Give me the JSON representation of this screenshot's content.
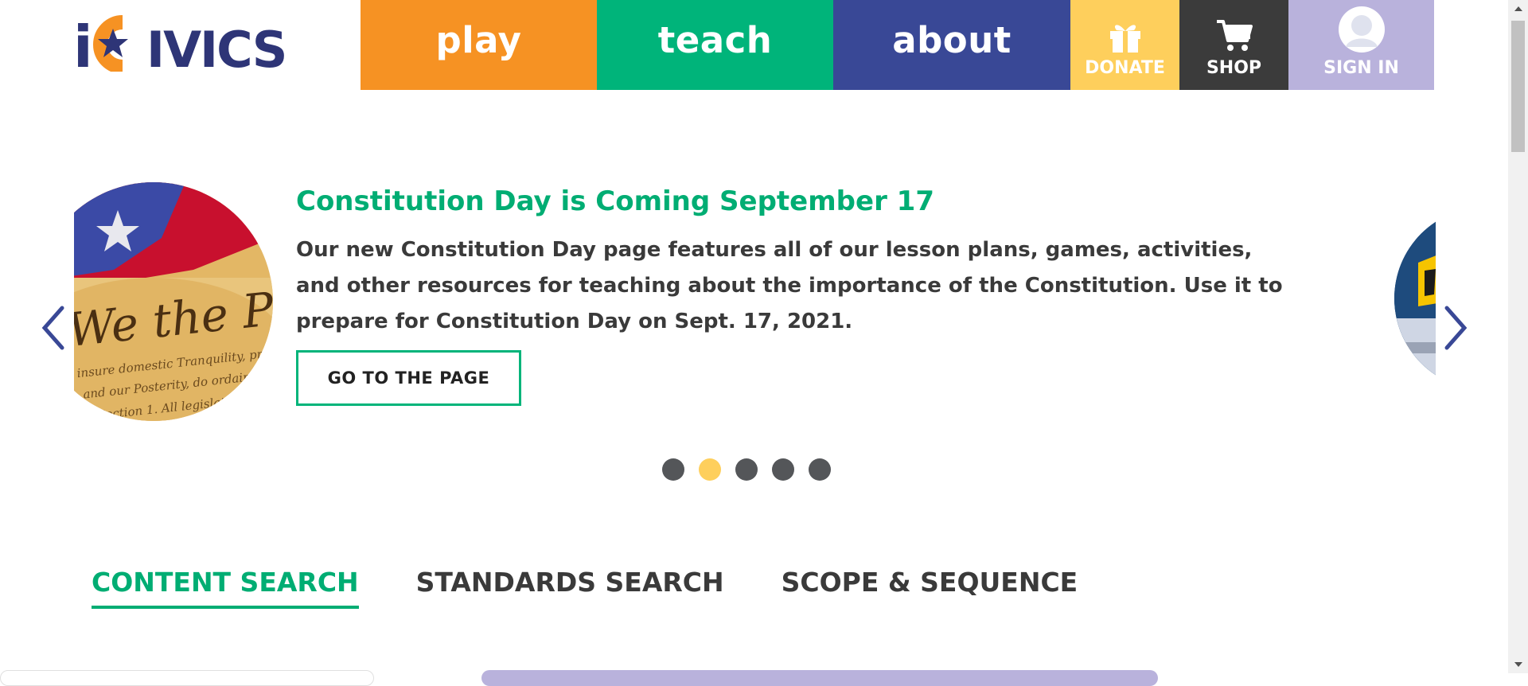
{
  "header": {
    "logo_text": "iCivics",
    "nav": {
      "play": "play",
      "teach": "teach",
      "about": "about",
      "donate": "DONATE",
      "shop": "SHOP",
      "signin": "SIGN IN"
    },
    "icons": {
      "donate": "gift-icon",
      "shop": "cart-icon",
      "signin": "user-avatar-icon"
    }
  },
  "carousel": {
    "title": "Constitution Day is Coming September 17",
    "text": "Our new Constitution Day page features all of our lesson plans, games, activities, and other resources for teaching about the importance of the Constitution. Use it to prepare for Constitution Day on Sept. 17, 2021.",
    "button": "GO TO THE PAGE",
    "image_text": "We the People",
    "slide_count": 5,
    "active_slide": 2
  },
  "tabs": [
    {
      "label": "CONTENT SEARCH",
      "active": true
    },
    {
      "label": "STANDARDS SEARCH",
      "active": false
    },
    {
      "label": "SCOPE & SEQUENCE",
      "active": false
    }
  ],
  "colors": {
    "orange": "#f69223",
    "green": "#00b47a",
    "blue": "#394896",
    "yellow": "#fecf5c",
    "dark": "#3b3b3b",
    "lavender": "#b9b2dc"
  }
}
